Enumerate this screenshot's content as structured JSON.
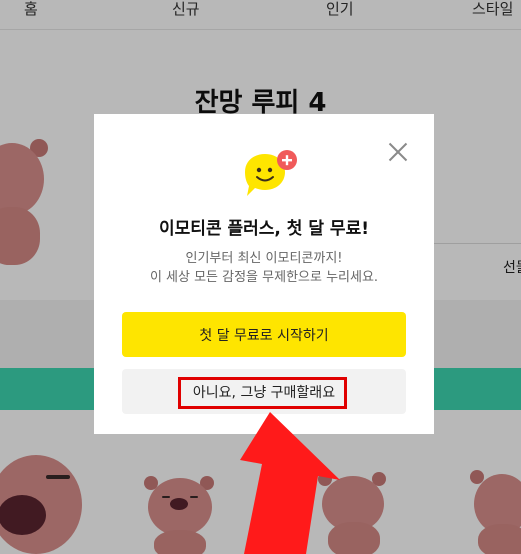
{
  "nav": {
    "items": [
      "홈",
      "신규",
      "인기",
      "스타일"
    ]
  },
  "page": {
    "title": "잔망 루피 4",
    "side_label": "선물"
  },
  "modal": {
    "title": "이모티콘 플러스, 첫 달 무료!",
    "description_line1": "인기부터 최신 이모티콘까지!",
    "description_line2": "이 세상 모든 감정을 무제한으로 누리세요.",
    "primary_button": "첫 달 무료로 시작하기",
    "secondary_button": "아니요, 그냥 구매할래요"
  },
  "colors": {
    "accent_yellow": "#fee500",
    "mint": "#3ed6b0",
    "highlight_red": "#e00000",
    "badge_red": "#f05a5a"
  },
  "icons": {
    "close": "close-icon",
    "emoticon": "smiley-plus-icon",
    "annotation": "red-arrow-icon"
  }
}
